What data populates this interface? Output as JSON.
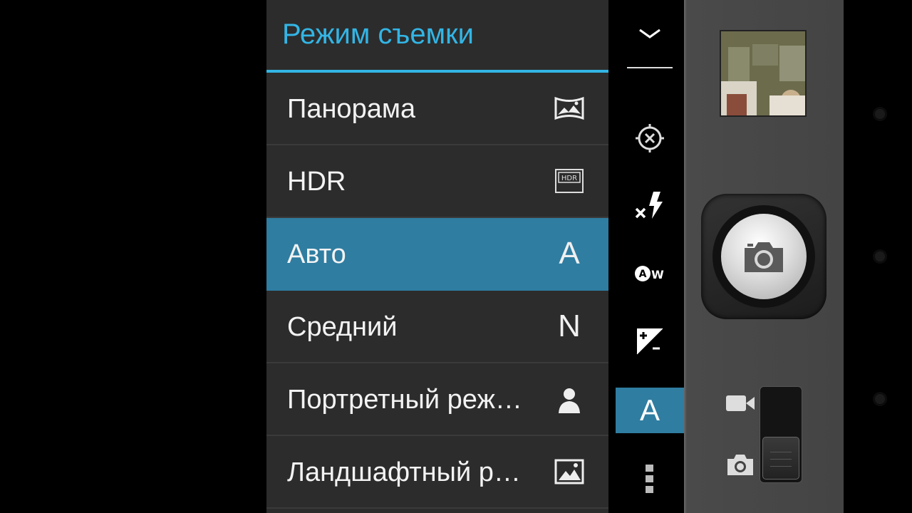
{
  "menu": {
    "title": "Режим съемки",
    "items": [
      {
        "label": "Панорама",
        "icon": "panorama-icon"
      },
      {
        "label": "HDR",
        "icon": "hdr-icon"
      },
      {
        "label": "Авто",
        "icon": "auto-icon",
        "icon_text": "A",
        "selected": true
      },
      {
        "label": "Средний",
        "icon": "normal-icon",
        "icon_text": "N"
      },
      {
        "label": "Портретный реж…",
        "icon": "portrait-icon"
      },
      {
        "label": "Ландшафтный р…",
        "icon": "landscape-icon"
      }
    ]
  },
  "toolbar": {
    "buttons": [
      {
        "icon": "collapse-chevron-icon"
      },
      {
        "icon": "focus-mode-icon"
      },
      {
        "icon": "flash-off-icon"
      },
      {
        "icon": "white-balance-auto-icon"
      },
      {
        "icon": "exposure-icon"
      },
      {
        "icon": "scene-mode-icon",
        "text": "A"
      },
      {
        "icon": "more-options-icon"
      }
    ]
  },
  "panel": {
    "thumbnail": "last-photo-thumbnail",
    "shutter": "camera-shutter-button",
    "mode_switch": {
      "options": [
        "video",
        "photo"
      ],
      "selected": "photo"
    }
  },
  "colors": {
    "accent": "#33b5e5",
    "selected_row": "#2f7da1",
    "menu_background": "#2c2c2c"
  }
}
